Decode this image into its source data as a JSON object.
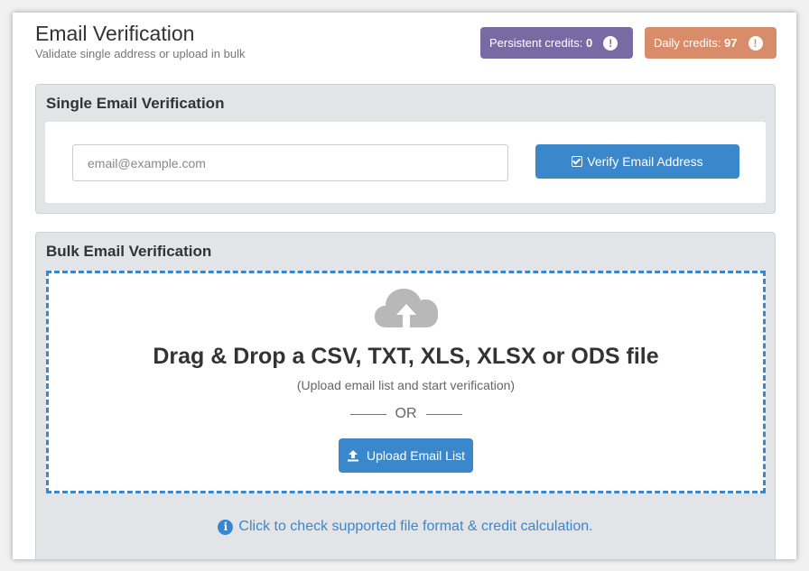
{
  "header": {
    "title": "Email Verification",
    "subtitle": "Validate single address or upload in bulk"
  },
  "credits": {
    "persistent_label": "Persistent credits:",
    "persistent_value": "0",
    "daily_label": "Daily credits:",
    "daily_value": "97",
    "info_glyph": "!"
  },
  "single": {
    "title": "Single Email Verification",
    "placeholder": "email@example.com",
    "value": "",
    "verify_label": "Verify Email Address"
  },
  "bulk": {
    "title": "Bulk Email Verification",
    "drop_title": "Drag & Drop a CSV, TXT, XLS, XLSX or ODS file",
    "drop_subtitle": "(Upload email list and start verification)",
    "or_text": "OR",
    "upload_label": "Upload Email List",
    "info_text": "Click to check supported file format & credit calculation.",
    "info_glyph": "i"
  },
  "icons": {
    "cloud": "cloud-upload-icon",
    "check": "check-square-icon",
    "upload": "upload-icon",
    "info": "info-circle-icon",
    "exclamation": "exclamation-circle-icon"
  },
  "colors": {
    "accent": "#3b87cc",
    "persistent_badge": "#7a6aa3",
    "daily_badge": "#d98c6a",
    "panel_bg": "#e3e4e8"
  }
}
